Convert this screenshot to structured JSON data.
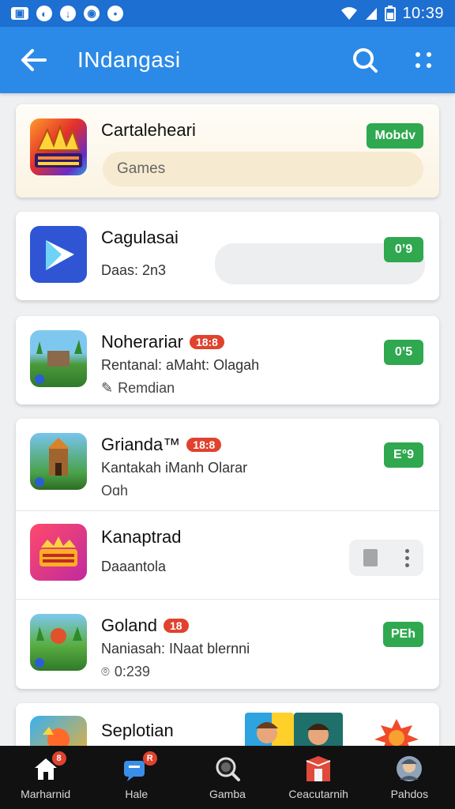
{
  "status_bar": {
    "time": "10:39"
  },
  "app_bar": {
    "title": "INdangasi"
  },
  "cards": [
    {
      "name": "Cartaleheari",
      "field_text": "Games",
      "action": "Mobdv"
    },
    {
      "name": "Cagulasai",
      "sub": "Daas: 2n3",
      "action": "0ʼ9"
    },
    {
      "name": "Noherariar",
      "badge": "18:8",
      "sub": "Rentanal: aMaht: Olagah",
      "sub2": "Remdian",
      "action": "0ʼ5"
    }
  ],
  "list_group": [
    {
      "name": "Grianda™",
      "badge": "18:8",
      "sub": "Kantakah iManh Olarar",
      "sub2": "Oɑh",
      "action": "E°9"
    },
    {
      "name": "Kanaptrad",
      "sub": "Daaantola"
    },
    {
      "name": "Goland",
      "badge": "18",
      "sub": "Naniasah: INaat blernni",
      "sub2": "0:239",
      "action": "PEh"
    }
  ],
  "partial_card": {
    "name": "Seplotian"
  },
  "bottom_nav": [
    {
      "label": "Marharnid",
      "badge": "8",
      "icon": "home-icon"
    },
    {
      "label": "Hale",
      "badge": "R",
      "icon": "chat-icon"
    },
    {
      "label": "Gamba",
      "icon": "search-icon"
    },
    {
      "label": "Ceacutarnih",
      "icon": "store-icon"
    },
    {
      "label": "Pahdos",
      "icon": "profile-icon"
    }
  ],
  "colors": {
    "status_bar": "#1d6fd1",
    "app_bar": "#2b8ae8",
    "action_green": "#2fa84f",
    "badge_red": "#e0422e",
    "nav_bg": "#111111"
  }
}
